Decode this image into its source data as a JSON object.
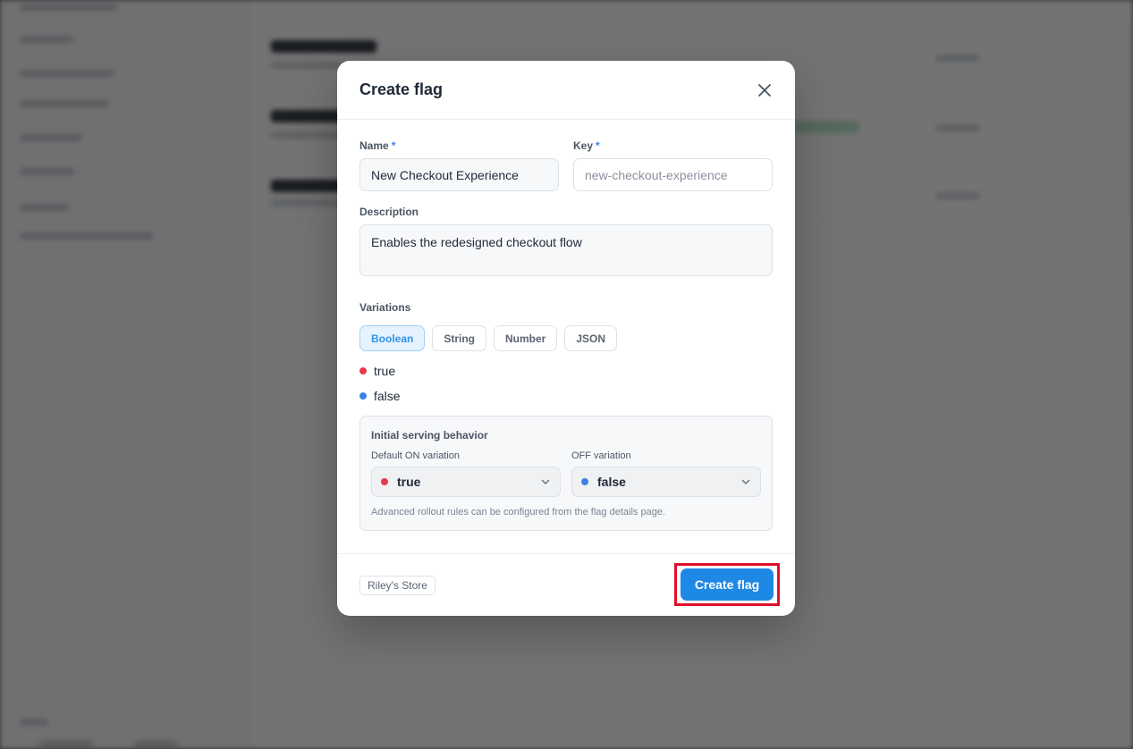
{
  "modal": {
    "title": "Create flag",
    "name_label": "Name",
    "name_value": "New Checkout Experience",
    "key_label": "Key",
    "key_placeholder": "new-checkout-experience",
    "required_mark": "*",
    "description_label": "Description",
    "description_value": "Enables the redesigned checkout flow",
    "variations_label": "Variations",
    "variation_types": [
      "Boolean",
      "String",
      "Number",
      "JSON"
    ],
    "selected_variation_type": "Boolean",
    "variations": [
      {
        "label": "true",
        "color": "#e5394d"
      },
      {
        "label": "false",
        "color": "#3b82e6"
      }
    ],
    "serving": {
      "title": "Initial serving behavior",
      "on_label": "Default ON variation",
      "on_value": "true",
      "off_label": "OFF variation",
      "off_value": "false",
      "hint": "Advanced rollout rules can be configured from the flag details page."
    },
    "footer": {
      "store": "Riley's Store",
      "create_button": "Create flag"
    }
  },
  "colors": {
    "accent": "#1e88e5",
    "highlight": "#e0102a",
    "true_dot": "#e5394d",
    "false_dot": "#3b82e6"
  }
}
